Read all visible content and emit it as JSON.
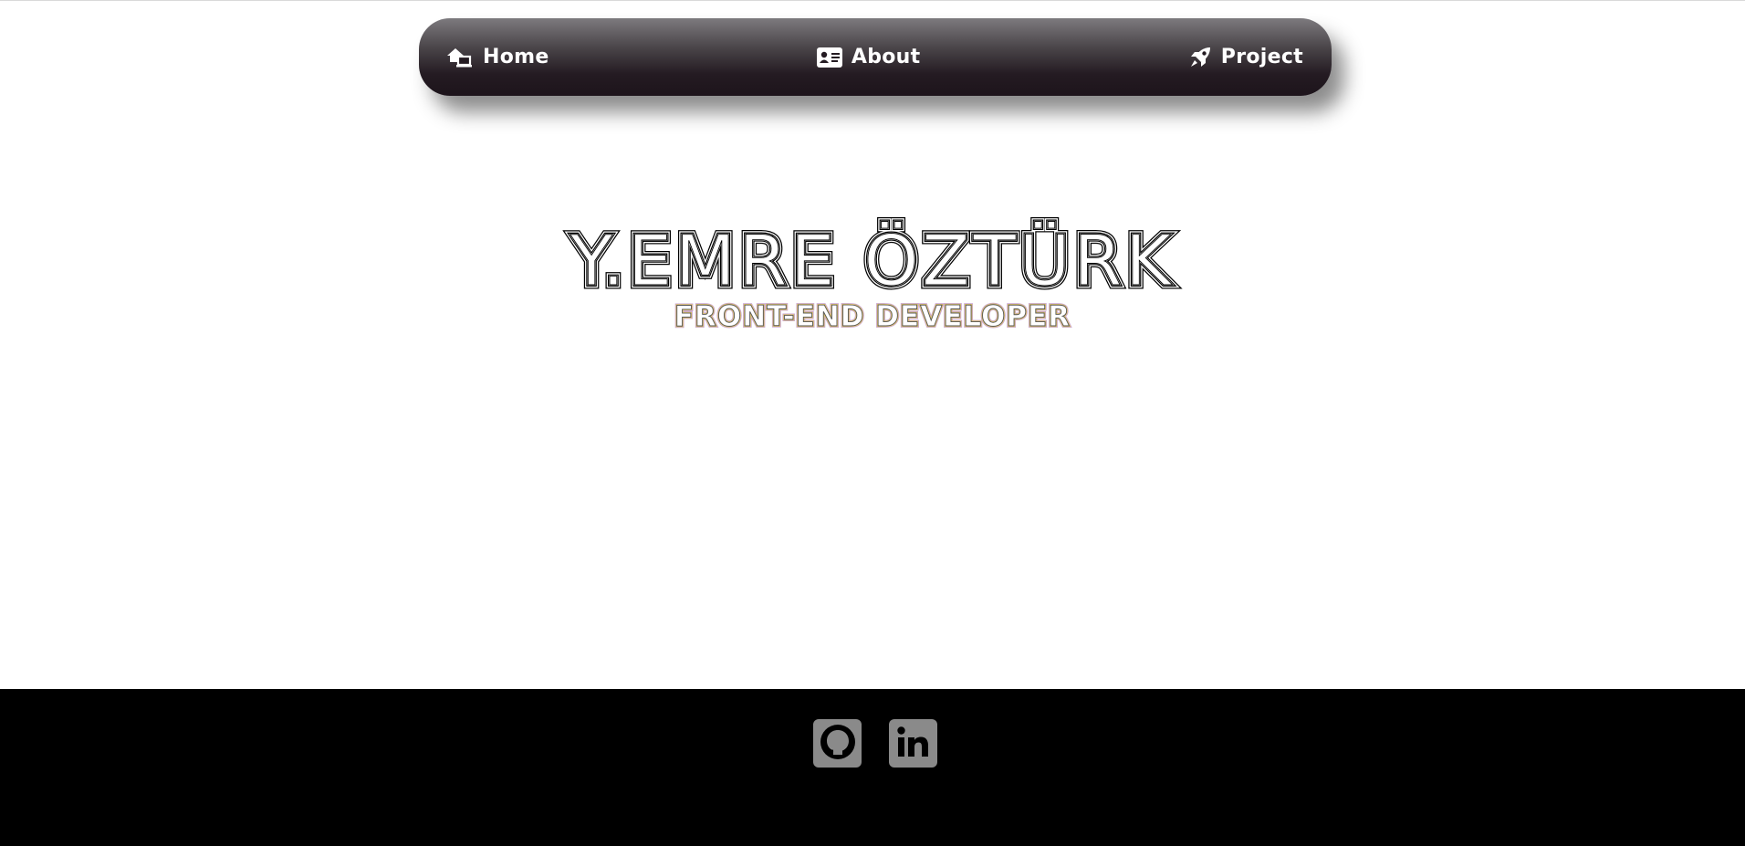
{
  "nav": {
    "items": [
      {
        "label": "Home",
        "icon": "home-laptop-icon"
      },
      {
        "label": "About",
        "icon": "id-card-icon"
      },
      {
        "label": "Project",
        "icon": "rocket-icon"
      }
    ]
  },
  "hero": {
    "name": "Y.EMRE ÖZTÜRK",
    "role": "FRONT-END DEVELOPER"
  },
  "footer": {
    "links": [
      {
        "name": "GitHub",
        "icon": "github-icon"
      },
      {
        "name": "LinkedIn",
        "icon": "linkedin-icon"
      }
    ]
  },
  "colors": {
    "nav_top": "#7d7a7e",
    "nav_bottom": "#1d141b",
    "footer_bg": "#000000",
    "social_tile": "#8a8a8a",
    "role_stroke_a": "#c9a6d6",
    "role_stroke_b": "#e0c46a"
  }
}
